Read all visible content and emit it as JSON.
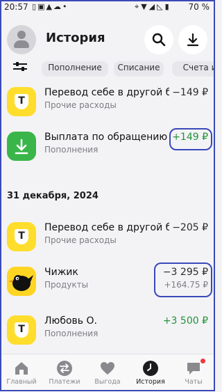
{
  "status_bar": {
    "time": "20:57",
    "left_icons": [
      "sim-icon",
      "photo-icon",
      "alert-icon",
      "cloud-icon",
      "dot-icon"
    ],
    "right_icons": [
      "location-icon",
      "wifi-icon",
      "signal-icon",
      "signal-off-icon"
    ],
    "battery": "70 %"
  },
  "header": {
    "title": "История",
    "search_icon": "search-icon",
    "download_icon": "download-icon"
  },
  "filters": {
    "chips": [
      "Пополнение",
      "Списание",
      "Счета и"
    ]
  },
  "transactions_top": [
    {
      "name": "Перевод себе в другой ба…",
      "category": "Прочие расходы",
      "amount": "−149 ₽",
      "logo": "tinkoff",
      "sign": "neg"
    },
    {
      "name": "Выплата по обращению A…",
      "category": "Пополнения",
      "amount": "+149 ₽",
      "logo": "green-download",
      "sign": "pos"
    }
  ],
  "date_group": "31 декабря, 2024",
  "transactions_bottom": [
    {
      "name": "Перевод себе в другой ба…",
      "category": "Прочие расходы",
      "amount": "−205 ₽",
      "logo": "tinkoff",
      "sign": "neg"
    },
    {
      "name": "Чижик",
      "category": "Продукты",
      "amount": "−3 295 ₽",
      "cashback": "+164.75 ₽",
      "logo": "chizhik",
      "sign": "neg"
    },
    {
      "name": "Любовь О.",
      "category": "Пополнения",
      "amount": "+3 500 ₽",
      "logo": "tinkoff",
      "sign": "pos"
    }
  ],
  "tabs": [
    {
      "label": "Главный",
      "icon": "home-icon",
      "active": false
    },
    {
      "label": "Платежи",
      "icon": "transfer-icon",
      "active": false
    },
    {
      "label": "Выгода",
      "icon": "heart-icon",
      "active": false
    },
    {
      "label": "История",
      "icon": "clock-icon",
      "active": true
    },
    {
      "label": "Чаты",
      "icon": "chat-icon",
      "active": false,
      "badge": true
    }
  ],
  "colors": {
    "positive": "#23913a",
    "highlight": "#3a49b8",
    "brand_yellow": "#ffdd2d"
  }
}
